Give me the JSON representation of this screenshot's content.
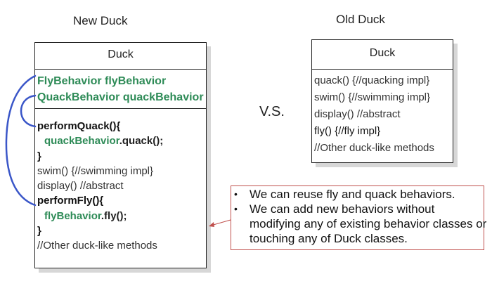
{
  "headings": {
    "new_duck": "New Duck",
    "old_duck": "Old Duck"
  },
  "new_duck_class": {
    "title": "Duck",
    "fields": [
      "FlyBehavior flyBehavior",
      "QuackBehavior quackBehavior"
    ],
    "perform_quack_sig": "performQuack(){",
    "quack_field": "quackBehavior",
    "quack_call": ".quack();",
    "close_1": "}",
    "swim": "swim() {//swimming impl}",
    "display": "display() //abstract",
    "perform_fly_sig": "performFly(){",
    "fly_field": "flyBehavior",
    "fly_call": ".fly();",
    "close_2": "}",
    "other": "//Other duck-like methods"
  },
  "old_duck_class": {
    "title": "Duck",
    "methods": [
      "quack() {//quacking impl}",
      "swim() {//swimming impl}",
      "display() //abstract",
      "fly() {//fly impl}",
      "//Other duck-like methods"
    ]
  },
  "vs_label": "V.S.",
  "callout": {
    "bullets": [
      "We can reuse fly and quack behaviors.",
      "We can add new behaviors without modifying any of existing behavior classes or touching any of Duck classes."
    ],
    "bullet_glyph": "•"
  },
  "colors": {
    "behavior_green": "#2e8b57",
    "connector_blue": "#3a56c8",
    "callout_border": "#c0504d"
  }
}
